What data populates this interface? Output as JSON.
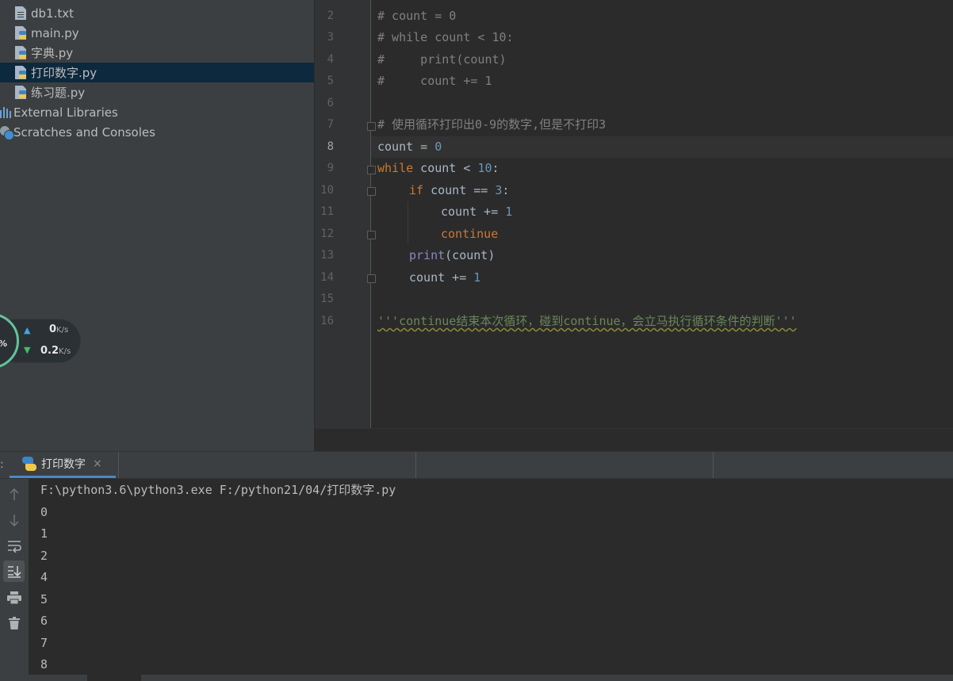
{
  "project_tree": {
    "items": [
      {
        "label": "db1.txt",
        "icon": "text-file-icon"
      },
      {
        "label": "main.py",
        "icon": "python-file-icon"
      },
      {
        "label": "字典.py",
        "icon": "python-file-icon"
      },
      {
        "label": "打印数字.py",
        "icon": "python-file-icon",
        "selected": true
      },
      {
        "label": "练习题.py",
        "icon": "python-file-icon"
      },
      {
        "label": "External Libraries",
        "icon": "library-icon"
      },
      {
        "label": "Scratches and Consoles",
        "icon": "scratches-icon"
      }
    ]
  },
  "network_widget": {
    "percent_suffix": "%",
    "upload_value": "0",
    "upload_unit": "K/s",
    "download_value": "0.2",
    "download_unit": "K/s"
  },
  "editor": {
    "current_line": 8,
    "line_numbers": [
      "2",
      "3",
      "4",
      "5",
      "6",
      "7",
      "8",
      "9",
      "10",
      "11",
      "12",
      "13",
      "14",
      "15",
      "16"
    ],
    "lines": {
      "l2": "# count = 0",
      "l3": "# while count < 10:",
      "l4": "#     print(count)",
      "l5": "#     count += 1",
      "l7": "# 使用循环打印出0-9的数字,但是不打印3",
      "l8_a": "count = ",
      "l8_b": "0",
      "l9_kw": "while",
      "l9_a": " count < ",
      "l9_num": "10",
      "l9_b": ":",
      "l10_kw": "if",
      "l10_a": " count == ",
      "l10_num": "3",
      "l10_b": ":",
      "l11_a": "count += ",
      "l11_num": "1",
      "l12_kw": "continue",
      "l13_bi": "print",
      "l13_a": "(count)",
      "l14_a": "count += ",
      "l14_num": "1",
      "l16_str": "'''continue结束本次循环，碰到continue，会立马执行循环条件的判断'''"
    }
  },
  "run_panel": {
    "tab_label": "打印数字",
    "tab_close": "×",
    "command": "F:\\python3.6\\python3.exe F:/python21/04/打印数字.py",
    "output": [
      "0",
      "1",
      "2",
      "4",
      "5",
      "6",
      "7",
      "8"
    ],
    "toolbar": [
      "up-arrow-icon",
      "down-arrow-icon",
      "soft-wrap-icon",
      "scroll-to-end-icon",
      "print-icon",
      "trash-icon"
    ]
  },
  "colors": {
    "keyword": "#cc7832",
    "number": "#6897bb",
    "comment": "#808080",
    "string": "#6a8759",
    "builtin": "#8888c6",
    "selection": "#0d293e",
    "accent": "#4a88c7"
  }
}
